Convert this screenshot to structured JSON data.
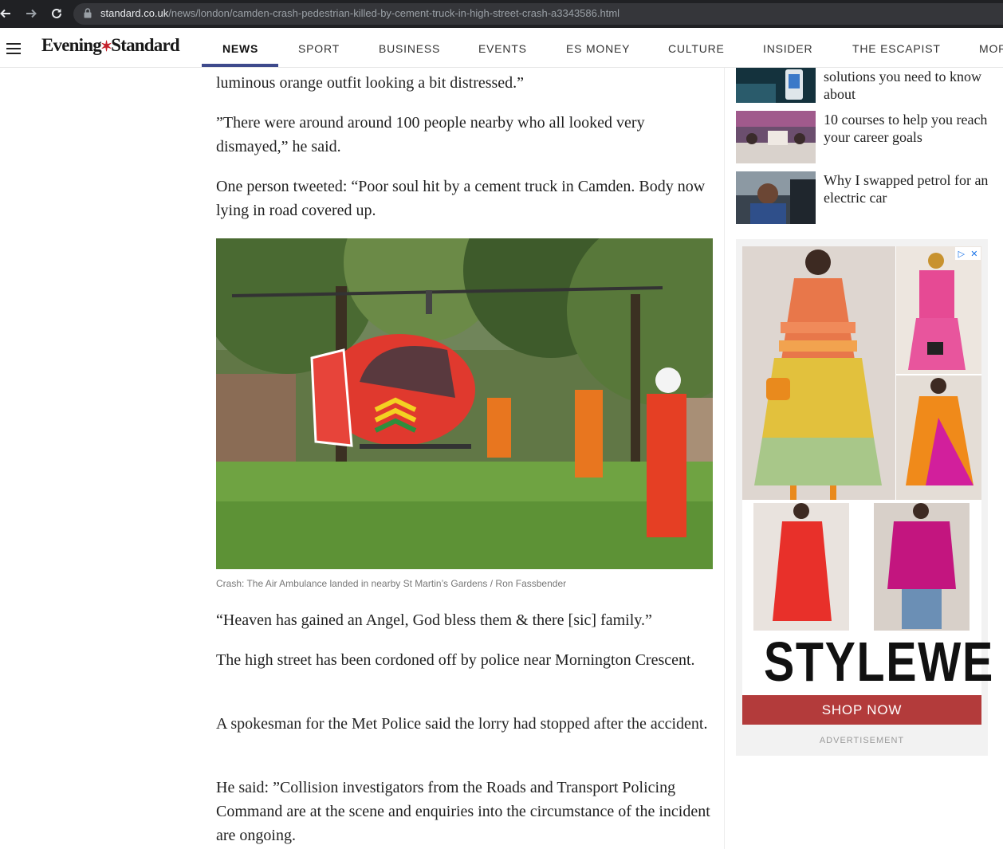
{
  "browser": {
    "url_host": "standard.co.uk",
    "url_path": "/news/london/camden-crash-pedestrian-killed-by-cement-truck-in-high-street-crash-a3343586.html"
  },
  "header": {
    "logo_left": "Evening",
    "logo_star": "✶",
    "logo_right": "Standard",
    "nav": [
      "NEWS",
      "SPORT",
      "BUSINESS",
      "EVENTS",
      "ES MONEY",
      "CULTURE",
      "INSIDER",
      "THE ESCAPIST",
      "MOR"
    ],
    "active_nav": "NEWS",
    "accent_color": "#3e4a8c"
  },
  "article": {
    "paragraphs": [
      "luminous orange outfit looking a bit distressed.”",
      "”There were around around 100 people nearby who all looked very dismayed,” he said.",
      "One person tweeted: “Poor soul hit by a cement truck in Camden. Body now lying in road covered up.",
      "“Heaven has gained an Angel, God bless them & there [sic] family.”",
      "The high street has been cordoned off by police near Mornington Crescent.",
      "A spokesman for the Met Police said the lorry had stopped after the accident.",
      "He said: ”Collision investigators from the Roads and Transport Policing Command are at the scene and enquiries into the circumstance of the incident are ongoing."
    ],
    "photo_caption": "Crash: The Air Ambulance landed in nearby St Martin’s Gardens / Ron Fassbender"
  },
  "sidebar": {
    "related": [
      "solutions you need to know about",
      "10 courses to help you reach your career goals",
      "Why I swapped petrol for an electric car"
    ],
    "ad": {
      "brand": "STYLEWE",
      "cta": "SHOP NOW",
      "label": "ADVERTISEMENT",
      "cta_color": "#b33b3b"
    }
  }
}
